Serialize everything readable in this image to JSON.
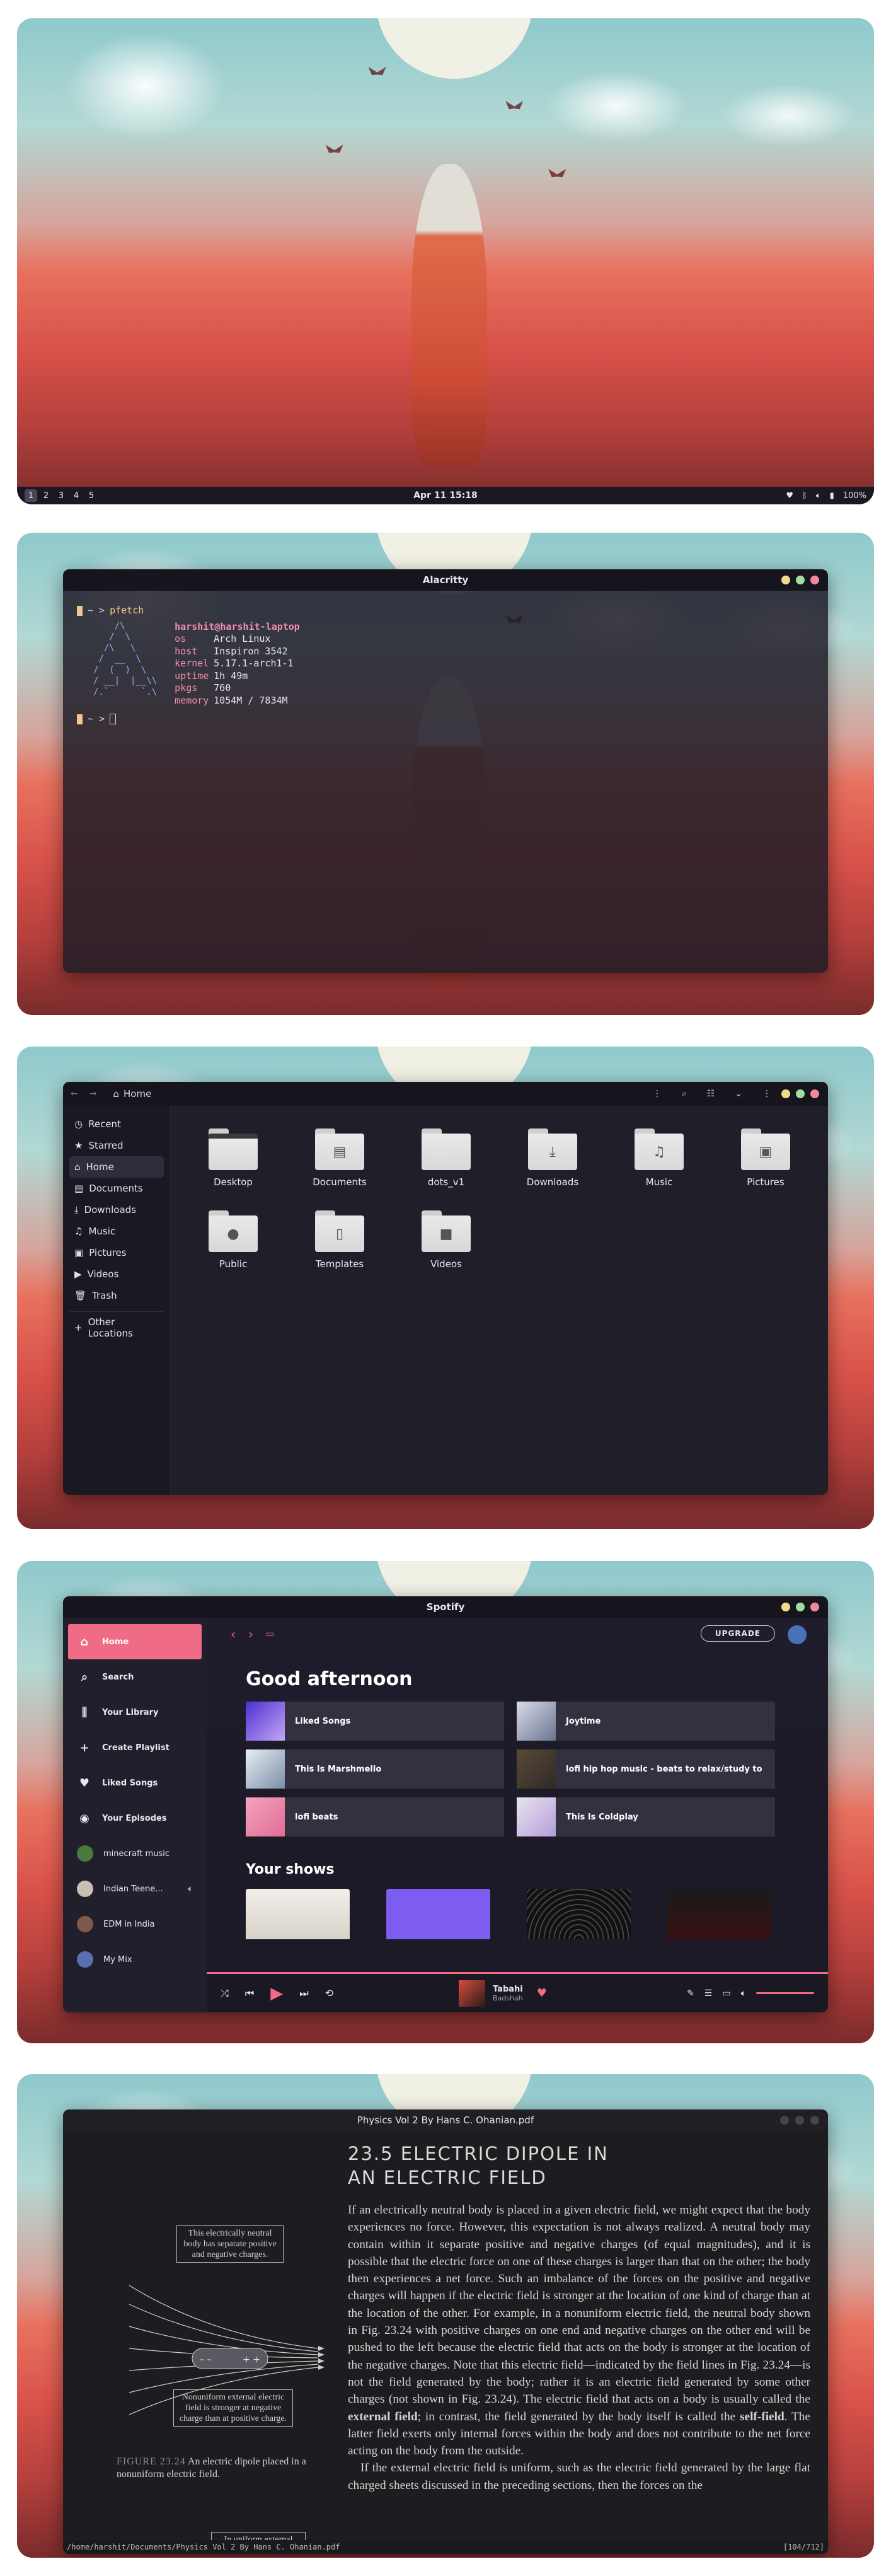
{
  "desktop": {
    "workspaces": [
      "1",
      "2",
      "3",
      "4",
      "5"
    ],
    "active_workspace": "1",
    "clock": "Apr 11  15:18",
    "tray_icons": [
      "heart-icon",
      "bluetooth-icon",
      "volume-icon",
      "battery-icon"
    ],
    "battery": "100%"
  },
  "terminal": {
    "title": "Alacritty",
    "prompt": "~ >",
    "command": "pfetch",
    "ascii_art": "    /\\\n   /  \\\n  /\\   \\\n /  __  \\\n/  (  )  \\\n/ __|  |__\\\\\n/.`      `.\\",
    "user_host": "harshit@harshit-laptop",
    "info": [
      {
        "key": "os",
        "value": "Arch Linux"
      },
      {
        "key": "host",
        "value": "Inspiron 3542"
      },
      {
        "key": "kernel",
        "value": "5.17.1-arch1-1"
      },
      {
        "key": "uptime",
        "value": "1h 49m"
      },
      {
        "key": "pkgs",
        "value": "760"
      },
      {
        "key": "memory",
        "value": "1054M / 7834M"
      }
    ]
  },
  "files": {
    "location": "Home",
    "sidebar": [
      "Recent",
      "Starred",
      "Home",
      "Documents",
      "Downloads",
      "Music",
      "Pictures",
      "Videos",
      "Trash"
    ],
    "other_locations": "Other Locations",
    "items": [
      "Desktop",
      "Documents",
      "dots_v1",
      "Downloads",
      "Music",
      "Pictures",
      "Public",
      "Templates",
      "Videos"
    ]
  },
  "spotify": {
    "title": "Spotify",
    "nav": [
      "Home",
      "Search",
      "Your Library",
      "Create Playlist",
      "Liked Songs",
      "Your Episodes"
    ],
    "playlists": [
      "minecraft music",
      "Indian Teene...",
      "EDM in India",
      "My Mix"
    ],
    "upgrade": "UPGRADE",
    "greeting": "Good afternoon",
    "tiles": [
      "Liked Songs",
      "Joytime",
      "This Is Marshmello",
      "lofi hip hop music - beats to relax/study to",
      "lofi beats",
      "This Is Coldplay"
    ],
    "shows_heading": "Your shows",
    "now_playing": {
      "title": "Tabahi",
      "artist": "Badshah"
    }
  },
  "pdf": {
    "title": "Physics Vol 2 By Hans C. Ohanian.pdf",
    "section_heading_1": "23.5  ELECTRIC DIPOLE IN",
    "section_heading_2": "AN ELECTRIC FIELD",
    "paragraph_1": "If an electrically neutral body is placed in a given electric field, we might expect that the body experiences no force. However, this expectation is not always realized. A neutral body may contain within it separate positive and negative charges (of equal magnitudes), and it is possible that the electric force on one of these charges is larger than that on the other; the body then experiences a net force. Such an imbalance of the forces on the positive and negative charges will happen if the electric field is stronger at the location of one kind of charge than at the location of the other. For example, in a nonuniform electric field, the neutral body shown in Fig. 23.24 with positive charges on one end and negative charges on the other end will be pushed to the left because the electric field that acts on the body is stronger at the location of the negative charges. Note that this electric field—indicated by the field lines in Fig. 23.24—is not the field generated by the body; rather it is an electric field generated by some other charges (not shown in Fig. 23.24). The electric field that acts on a body is usually called the",
    "term_1": "external field",
    "paragraph_1b": "; in contrast, the field generated by the body itself is called the",
    "term_2": "self-field",
    "paragraph_1c": ". The latter field exerts only internal forces within the body and does not contribute to the net force acting on the body from the outside.",
    "paragraph_2": "If the external electric field is uniform, such as the electric field generated by the large flat charged sheets discussed in the preceding sections, then the forces on the",
    "callout_1": "This electrically neutral body has separate positive and negative charges.",
    "callout_2": "Nonuniform external electric field is stronger at negative charge than at positive charge.",
    "callout_3": "In uniform external",
    "figure_label": "FIGURE 23.24",
    "figure_caption": "An electric dipole placed in a nonuniform electric field.",
    "status_path": "/home/harshit/Documents/Physics Vol 2 By Hans C. Ohanian.pdf",
    "status_page": "[104/712]"
  },
  "colors": {
    "accent": "#f06c86",
    "window_bg": "#1e1c27",
    "bar_bg": "#1b1822"
  }
}
